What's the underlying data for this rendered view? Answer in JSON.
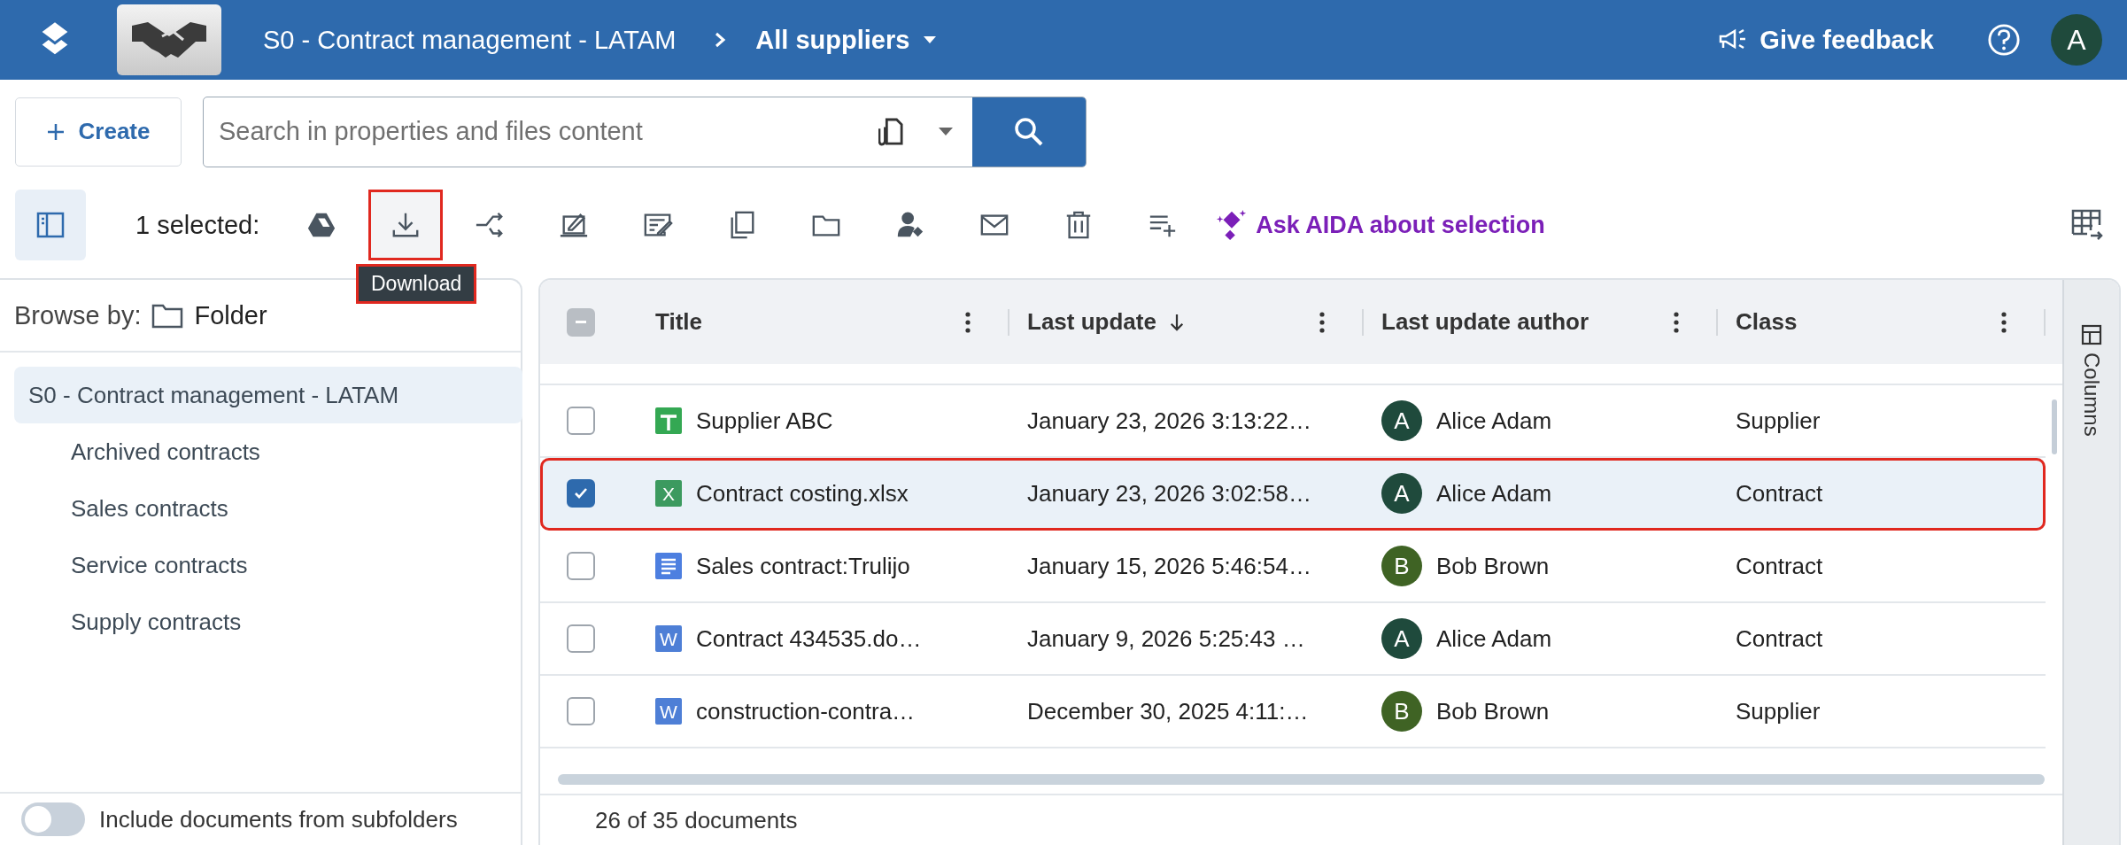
{
  "app_bar": {
    "breadcrumb": "S0 - Contract management - LATAM",
    "view": "All suppliers",
    "feedback": "Give feedback",
    "avatar": "A"
  },
  "create_button": "Create",
  "search": {
    "placeholder": "Search in properties and files content"
  },
  "selection_label": "1 selected:",
  "actions": [
    {
      "kind": "drive",
      "highlighted": false
    },
    {
      "kind": "download",
      "highlighted": true
    },
    {
      "kind": "move",
      "highlighted": false
    },
    {
      "kind": "sign",
      "highlighted": false
    },
    {
      "kind": "edit",
      "highlighted": false
    },
    {
      "kind": "copy",
      "highlighted": false
    },
    {
      "kind": "folder",
      "highlighted": false
    },
    {
      "kind": "assign",
      "highlighted": false
    },
    {
      "kind": "email",
      "highlighted": false
    },
    {
      "kind": "delete",
      "highlighted": false
    },
    {
      "kind": "add-to-list",
      "highlighted": false
    }
  ],
  "tooltip": "Download",
  "ai_action": "Ask AIDA about selection",
  "browse": {
    "label": "Browse by:",
    "value": "Folder"
  },
  "tree": [
    {
      "label": "S0 - Contract management - LATAM",
      "selected": true,
      "children": [
        {
          "label": "Archived contracts",
          "selected": false
        },
        {
          "label": "Sales contracts",
          "selected": false
        },
        {
          "label": "Service contracts",
          "selected": false
        },
        {
          "label": "Supply contracts",
          "selected": false
        }
      ]
    }
  ],
  "subfolders_toggle": {
    "label": "Include documents from subfolders",
    "on": false
  },
  "table": {
    "select_all": {
      "indeterminate": true
    },
    "columns": [
      {
        "label": "Title",
        "sorted": false
      },
      {
        "label": "Last update",
        "sorted": true
      },
      {
        "label": "Last update author",
        "sorted": false
      },
      {
        "label": "Class",
        "sorted": false
      }
    ],
    "rows": [
      {
        "kind": "sheet",
        "title": "Supplier ABC",
        "updated": "January 23, 2026 3:13:22…",
        "author": "Alice Adam",
        "initial": "A",
        "color": "#1f4a3c",
        "class": "Supplier",
        "selected": false,
        "highlighted": false
      },
      {
        "kind": "excel",
        "letter": "X",
        "title": "Contract costing.xlsx",
        "updated": "January 23, 2026 3:02:58…",
        "author": "Alice Adam",
        "initial": "A",
        "color": "#1f4a3c",
        "class": "Contract",
        "selected": true,
        "highlighted": true
      },
      {
        "kind": "doc",
        "title": "Sales contract:Trulijo",
        "updated": "January 15, 2026 5:46:54…",
        "author": "Bob Brown",
        "initial": "B",
        "color": "#3f6324",
        "class": "Contract",
        "selected": false,
        "highlighted": false
      },
      {
        "kind": "word",
        "letter": "W",
        "title": "Contract 434535.do…",
        "updated": "January 9, 2026 5:25:43 …",
        "author": "Alice Adam",
        "initial": "A",
        "color": "#1f4a3c",
        "class": "Contract",
        "selected": false,
        "highlighted": false
      },
      {
        "kind": "word",
        "letter": "W",
        "title": "construction-contra…",
        "updated": "December 30, 2025 4:11:…",
        "author": "Bob Brown",
        "initial": "B",
        "color": "#3f6324",
        "class": "Supplier",
        "selected": false,
        "highlighted": false
      }
    ]
  },
  "footer": "26 of 35 documents",
  "columns_panel": "Columns"
}
